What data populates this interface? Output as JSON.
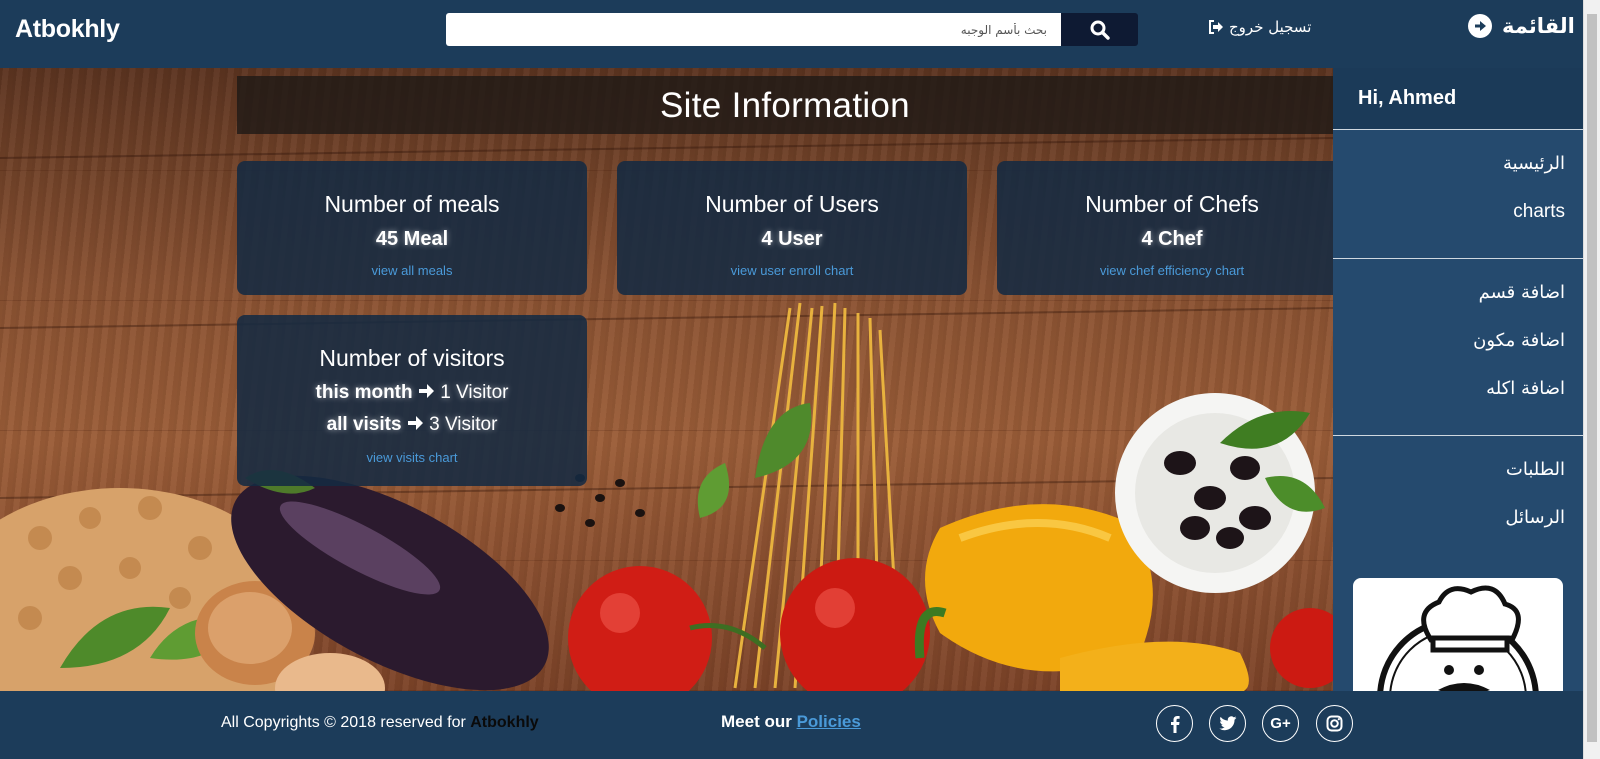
{
  "navbar": {
    "brand": "Atbokhly",
    "search_placeholder": "بحث بأسم الوجبه",
    "logout_label": "تسجيل خروج",
    "menu_label": "القائمة"
  },
  "main": {
    "banner_title": "Site Information",
    "cards": [
      {
        "title": "Number of meals",
        "value": "45 Meal",
        "link": "view all meals"
      },
      {
        "title": "Number of Users",
        "value": "4 User",
        "link": "view user enroll chart"
      },
      {
        "title": "Number of Chefs",
        "value": "4 Chef",
        "link": "view chef efficiency chart"
      }
    ],
    "visitors": {
      "title": "Number of visitors",
      "month_label": "this month",
      "month_value": "1 Visitor",
      "all_label": "all visits",
      "all_value": "3 Visitor",
      "link": "view visits chart"
    }
  },
  "sidebar": {
    "greeting": "Hi, Ahmed",
    "sections": [
      [
        "الرئيسية",
        "charts"
      ],
      [
        "اضافة قسم",
        "اضافة مكون",
        "اضافة اكله"
      ],
      [
        "الطلبات",
        "الرسائل"
      ]
    ]
  },
  "footer": {
    "copyright_prefix": "All Copyrights © 2018 reserved for",
    "copyright_brand": "Atbokhly",
    "policies_prefix": "Meet our",
    "policies_link": "Policies",
    "social": [
      "facebook-icon",
      "twitter-icon",
      "google-plus-icon",
      "instagram-icon"
    ]
  },
  "colors": {
    "navbar": "#1c3c5a",
    "sidebar": "#254a6e",
    "card": "#152a42",
    "link": "#4a9ad9",
    "search_button": "#0e1a33"
  }
}
